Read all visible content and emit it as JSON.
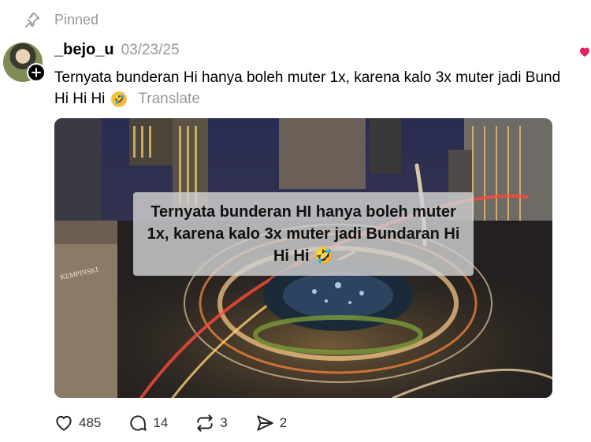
{
  "pinned": {
    "label": "Pinned",
    "icon": "pin-icon"
  },
  "post": {
    "username": "_bejo_u",
    "date": "03/23/25",
    "text_line1": "Ternyata bunderan Hi hanya boleh muter 1x, karena kalo 3x muter jadi Bund",
    "text_line2": "Hi Hi Hi",
    "emoji": "🤣",
    "translate_label": "Translate",
    "image_overlay_text": "Ternyata bunderan HI hanya boleh muter 1x, karena kalo 3x muter jadi Bundaran Hi Hi Hi 🤣",
    "image_sign_text": "KEMPINSKI"
  },
  "actions": {
    "likes": "485",
    "comments": "14",
    "reposts": "3",
    "shares": "2"
  },
  "colors": {
    "muted": "#999999",
    "text": "#000000",
    "accent_red": "#e0245e"
  }
}
